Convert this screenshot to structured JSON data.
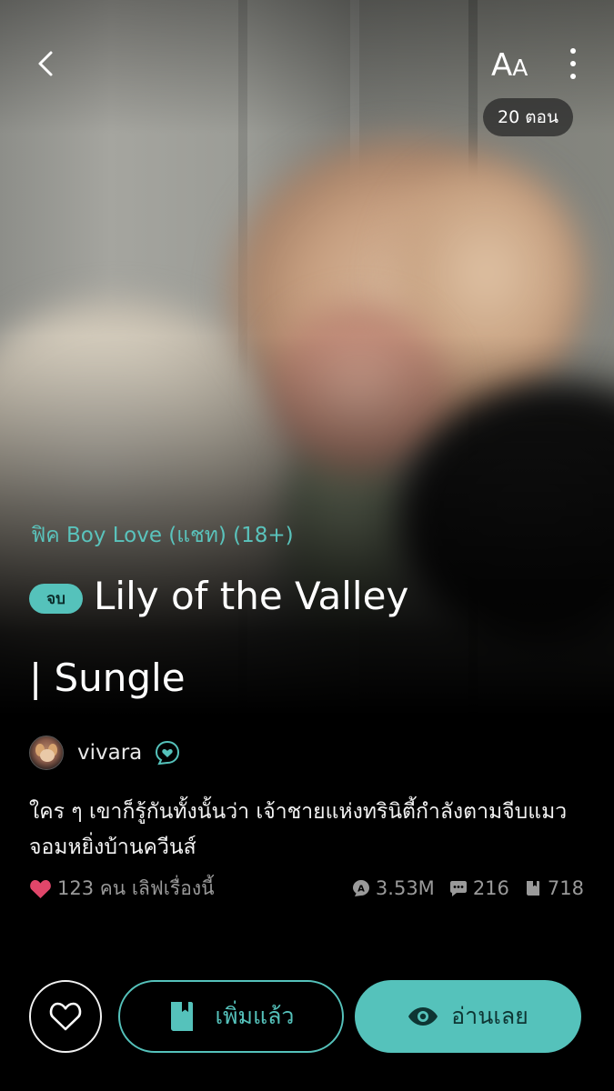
{
  "top_bar": {
    "back_icon": "chevron-left-icon",
    "font_size_icon": "font-size-icon",
    "font_size_label_big": "A",
    "font_size_label_small": "A",
    "more_icon": "more-vertical-icon",
    "episode_count": "20 ตอน"
  },
  "story": {
    "category": "ฟิค Boy Love (แชท) (18+)",
    "status_badge": "จบ",
    "title_line_1": "Lily of the Valley",
    "title_line_2": "| Sungle",
    "author": "vivara",
    "author_badge_icon": "heart-chat-badge-icon",
    "synopsis": "ใคร ๆ เขาก็รู้กันทั้งนั้นว่า เจ้าชายแห่งทรินิตี้กำลังตามจีบแมวจอมหยิ่งบ้านควีนส์"
  },
  "stats": {
    "likes_text": "123 คน เลิฟเรื่องนี้",
    "views": "3.53M",
    "comments": "216",
    "pages": "718"
  },
  "actions": {
    "favorite_icon": "heart-outline-icon",
    "library_label": "เพิ่มแล้ว",
    "read_label": "อ่านเลย"
  },
  "colors": {
    "accent": "#55c2bb",
    "heart": "#e0466a",
    "muted": "#9a9a9a"
  }
}
